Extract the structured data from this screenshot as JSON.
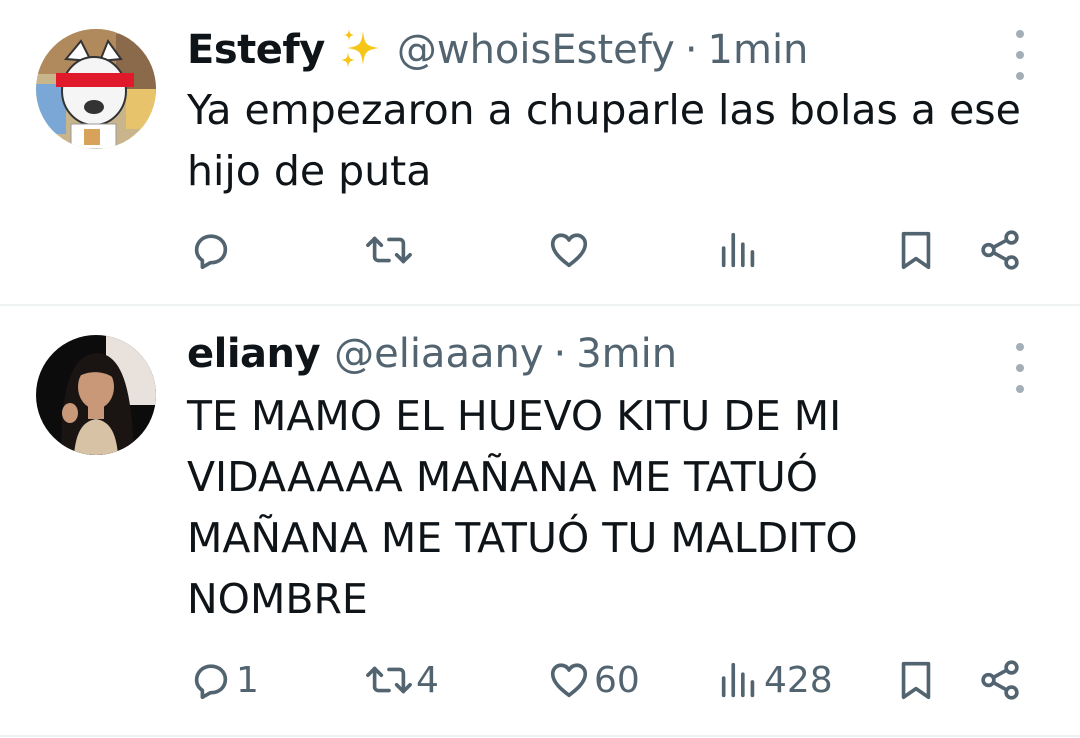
{
  "tweets": [
    {
      "display_name": "Estefy",
      "emoji": "✨",
      "handle": "@whoisEstefy",
      "separator": "·",
      "time": "1min",
      "text": "Ya empezaron a chuparle las bolas a ese\nhijo de puta",
      "replies": "",
      "retweets": "",
      "likes": "",
      "views": ""
    },
    {
      "display_name": "eliany",
      "handle": "@eliaaany",
      "separator": "·",
      "time": "3min",
      "text": "TE MAMO EL HUEVO KITU DE MI\nVIDAAAAA MAÑANA ME TATUÓ\nMAÑANA ME TATUÓ TU MALDITO\nNOMBRE",
      "replies": "1",
      "retweets": "4",
      "likes": "60",
      "views": "428"
    }
  ],
  "icons": {
    "reply": "reply-icon",
    "retweet": "retweet-icon",
    "like": "heart-icon",
    "views": "views-icon",
    "bookmark": "bookmark-icon",
    "share": "share-icon",
    "more": "more-options-icon"
  },
  "colors": {
    "text": "#0f1419",
    "secondary": "#536471",
    "divider": "#eff3f4",
    "sparkle": "#f5c518"
  }
}
